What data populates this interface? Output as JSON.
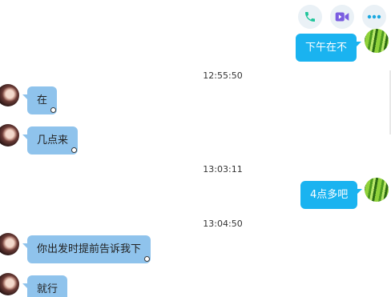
{
  "toolbar": {
    "icons": [
      "phone-icon",
      "video-call-icon",
      "more-icon"
    ]
  },
  "messages": [
    {
      "id": "m1",
      "direction": "outgoing",
      "text": "下午在不"
    },
    {
      "id": "t1",
      "type": "time",
      "text": "12:55:50"
    },
    {
      "id": "m2",
      "direction": "incoming",
      "text": "在"
    },
    {
      "id": "m3",
      "direction": "incoming",
      "text": "几点来"
    },
    {
      "id": "t2",
      "type": "time",
      "text": "13:03:11"
    },
    {
      "id": "m4",
      "direction": "outgoing",
      "text": "4点多吧"
    },
    {
      "id": "t3",
      "type": "time",
      "text": "13:04:50"
    },
    {
      "id": "m5",
      "direction": "incoming",
      "text": "你出发时提前告诉我下"
    },
    {
      "id": "m6",
      "direction": "incoming",
      "text": "就行"
    }
  ],
  "colors": {
    "incoming_bubble": "#8fc3ec",
    "outgoing_bubble": "#1ab3f0",
    "phone_icon": "#1ec59a",
    "video_icon": "#7a5de0",
    "more_icon": "#1aa8e0"
  }
}
